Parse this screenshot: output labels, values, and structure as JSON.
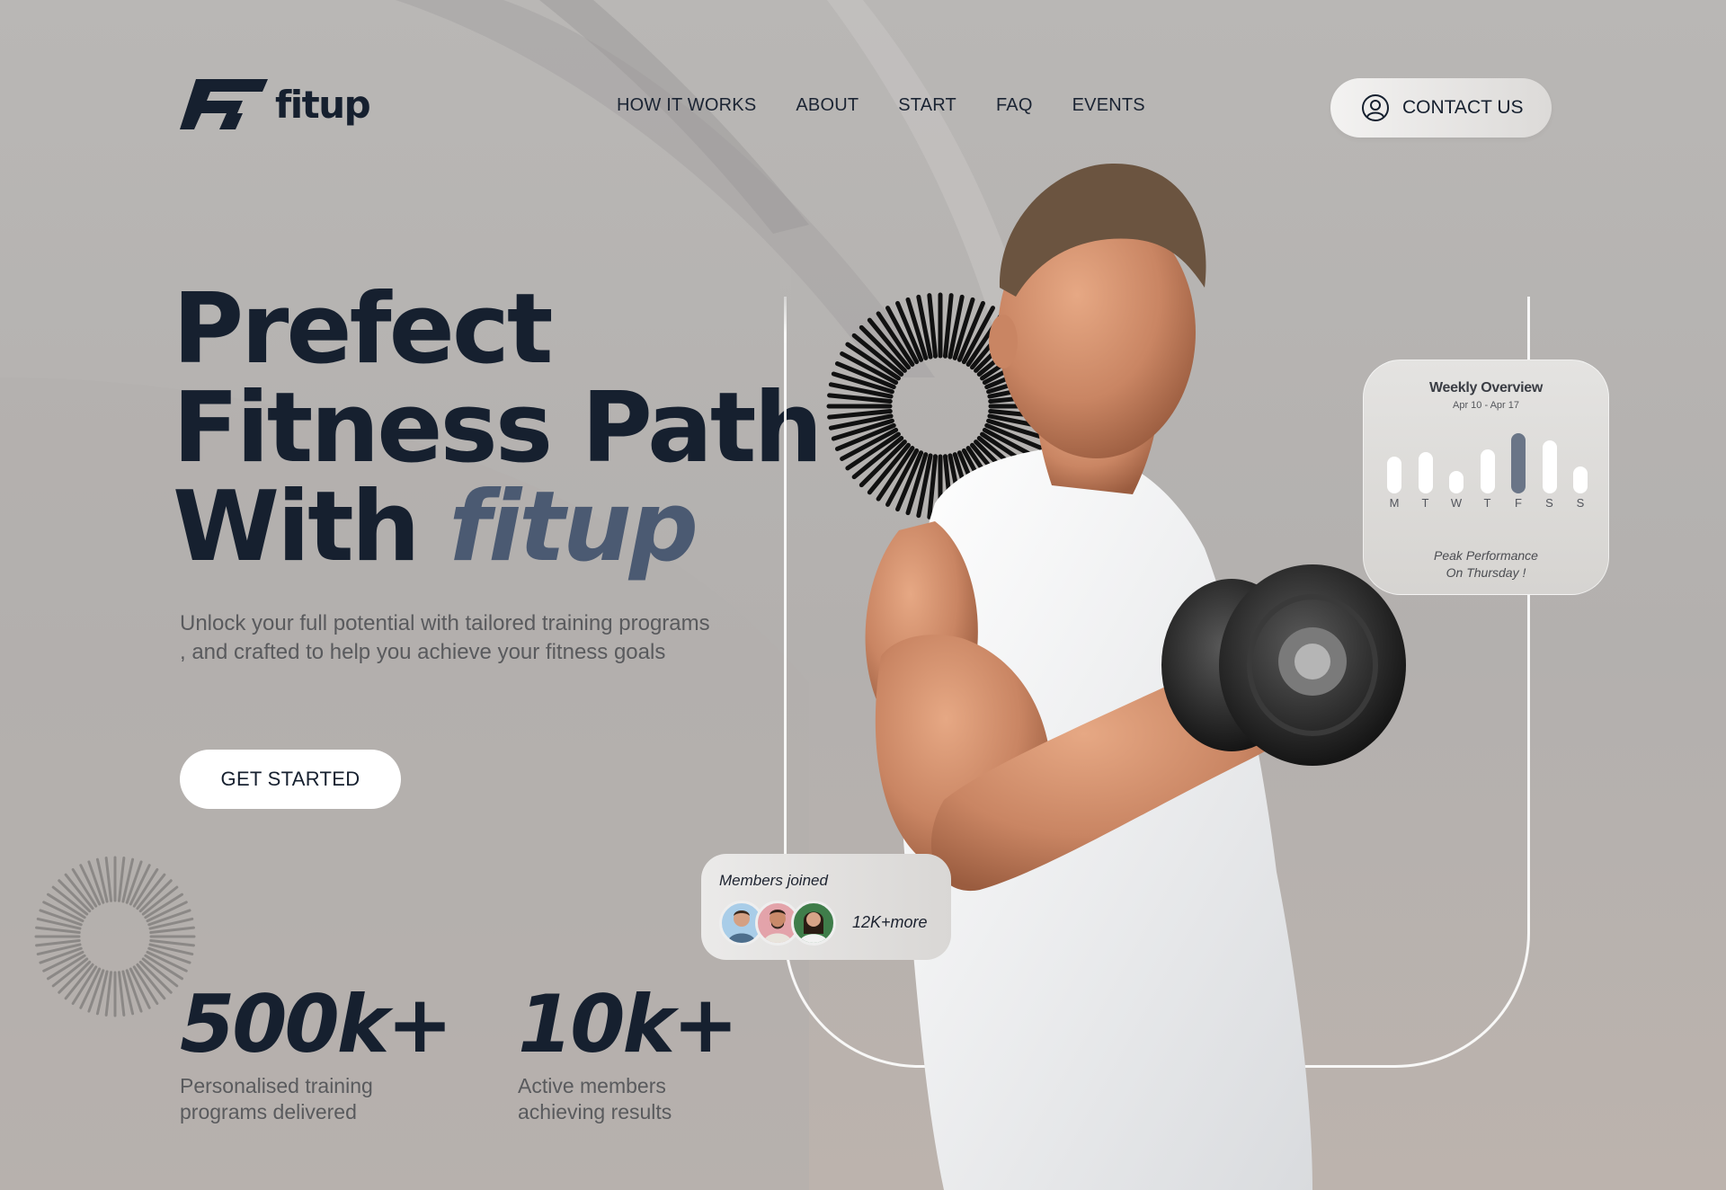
{
  "brand": {
    "name": "fitup"
  },
  "nav": {
    "items": [
      "HOW IT WORKS",
      "ABOUT",
      "START",
      "FAQ",
      "EVENTS"
    ]
  },
  "contact": {
    "label": "CONTACT US"
  },
  "hero": {
    "title_line1": "Prefect",
    "title_line2": "Fitness Path",
    "title_line3": "With",
    "title_accent": "fitup",
    "subtitle": "Unlock your full potential with tailored training programs , and crafted to help you achieve your fitness goals",
    "cta": "GET STARTED"
  },
  "stats": [
    {
      "value": "500k+",
      "label": "Personalised training programs delivered"
    },
    {
      "value": "10k+",
      "label": "Active members achieving results"
    }
  ],
  "weekly_overview": {
    "title": "Weekly Overview",
    "range": "Apr 10 - Apr 17",
    "note_line1": "Peak Performance",
    "note_line2": "On Thursday !",
    "days": [
      "M",
      "T",
      "W",
      "T",
      "F",
      "S",
      "S"
    ],
    "levels": [
      0.56,
      0.62,
      0.34,
      0.66,
      0.9,
      0.8,
      0.4
    ],
    "active_index": 4
  },
  "members": {
    "title": "Members joined",
    "count": "12K+more"
  },
  "colors": {
    "brand_dark": "#16202f",
    "accent": "#4b5a72",
    "background": "#b7b5b3",
    "bar_active": "#6a7587"
  }
}
